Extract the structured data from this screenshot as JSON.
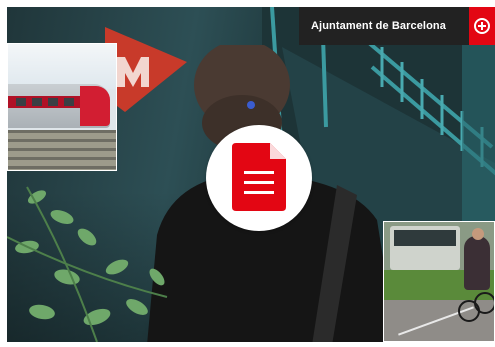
{
  "brand": {
    "name": "Ajuntament de Barcelona",
    "logo_icon": "barcelona-seal-icon"
  },
  "document_link": {
    "icon": "document-icon"
  },
  "colors": {
    "brand_red": "#e30613",
    "header_bar": "#222222",
    "badge_bg": "#ffffff"
  }
}
